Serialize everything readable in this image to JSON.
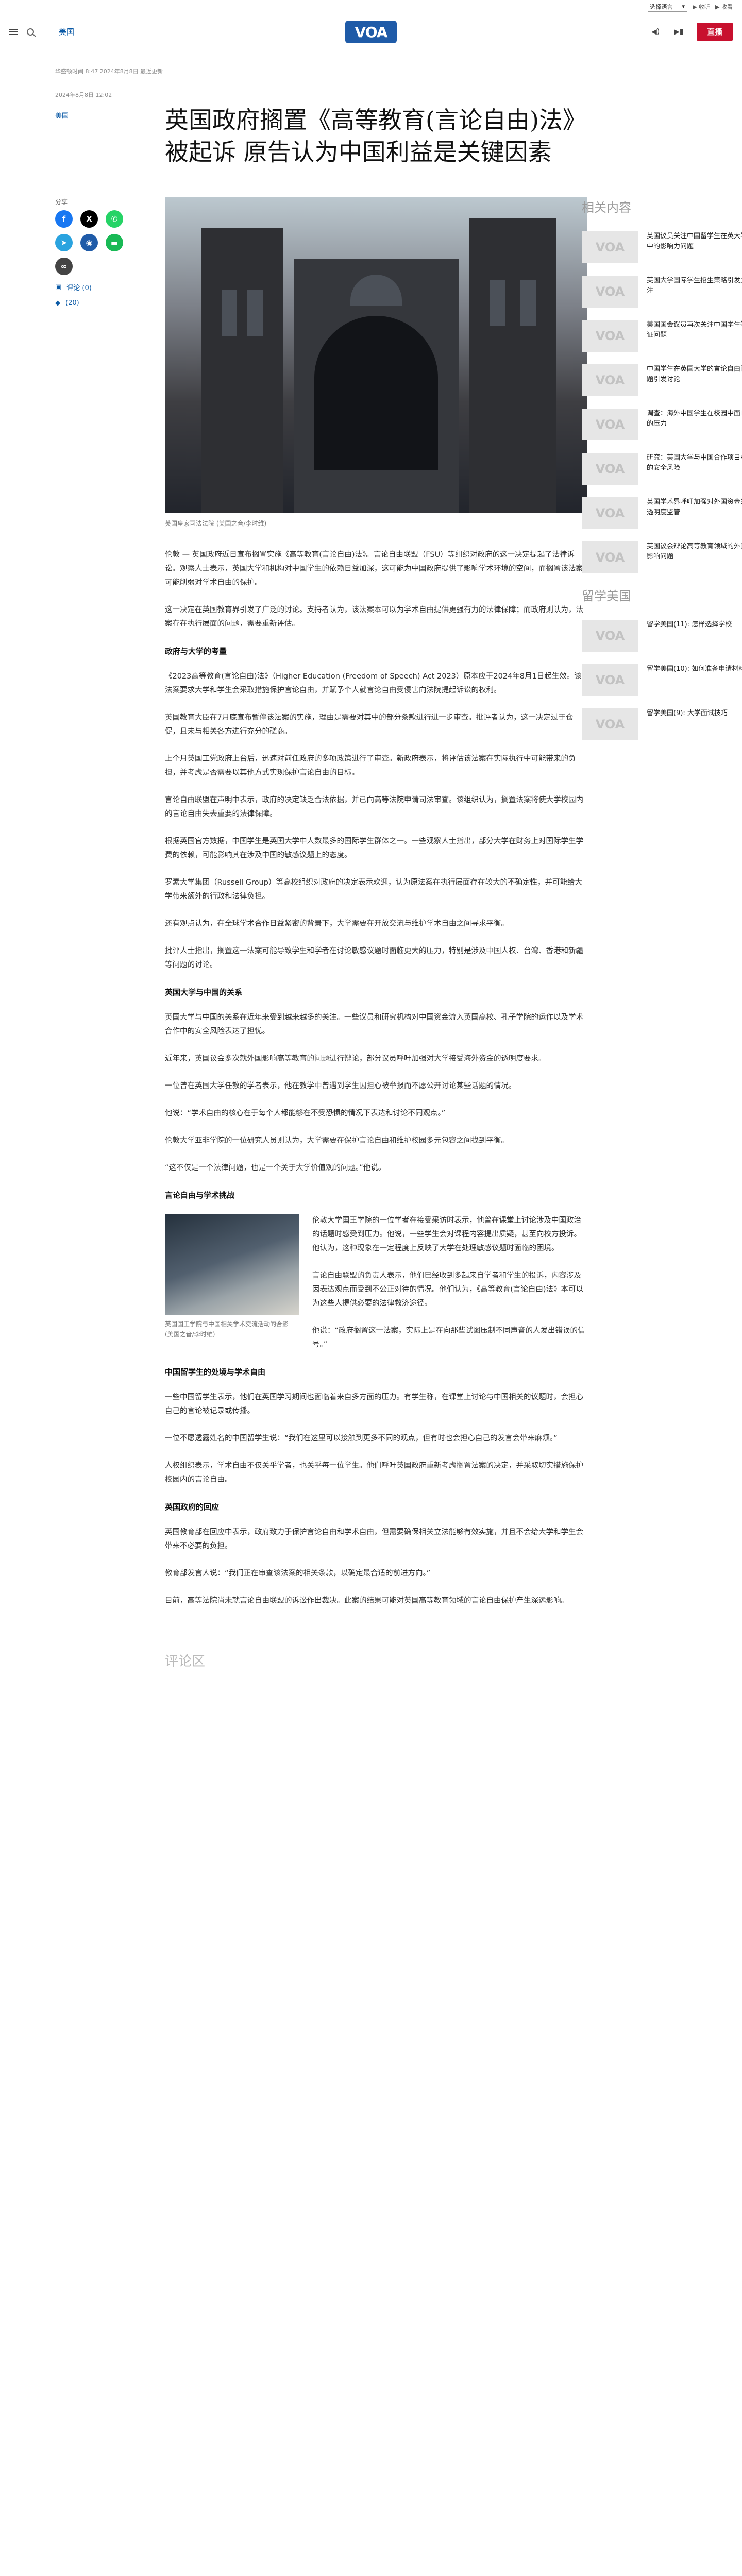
{
  "lang_strip": {
    "select_value": "选择语言",
    "links": [
      "▶ 收听",
      "▶ 收看"
    ]
  },
  "header": {
    "section_link": "美国",
    "logo_text": "VOA",
    "live_label": "直播"
  },
  "article": {
    "meta_top": "华盛顿时间 8:47 2024年8月8日 最近更新",
    "meta_published": "2024年8月8日 12:02",
    "category": "美国",
    "title": "英国政府搁置《高等教育(言论自由)法》被起诉 原告认为中国利益是关键因素",
    "hero_caption": "英国皇家司法法院 (美国之音/李时维)"
  },
  "share": {
    "label": "分享",
    "stats": [
      "评论 (0)",
      "(20)"
    ]
  },
  "body": [
    {
      "type": "p",
      "text": "伦敦 — 英国政府近日宣布搁置实施《高等教育(言论自由)法》。言论自由联盟（FSU）等组织对政府的这一决定提起了法律诉讼。观察人士表示，英国大学和机构对中国学生的依赖日益加深，这可能为中国政府提供了影响学术环境的空间，而搁置该法案可能削弱对学术自由的保护。"
    },
    {
      "type": "p",
      "text": "这一决定在英国教育界引发了广泛的讨论。支持者认为，该法案本可以为学术自由提供更强有力的法律保障；而政府则认为，法案存在执行层面的问题，需要重新评估。"
    },
    {
      "type": "h2",
      "text": "政府与大学的考量"
    },
    {
      "type": "p",
      "text": "《2023高等教育(言论自由)法》（Higher Education (Freedom of Speech) Act 2023）原本应于2024年8月1日起生效。该法案要求大学和学生会采取措施保护言论自由，并赋予个人就言论自由受侵害向法院提起诉讼的权利。"
    },
    {
      "type": "p",
      "text": "英国教育大臣在7月底宣布暂停该法案的实施，理由是需要对其中的部分条款进行进一步审查。批评者认为，这一决定过于仓促，且未与相关各方进行充分的磋商。"
    },
    {
      "type": "p",
      "text": "上个月英国工党政府上台后，迅速对前任政府的多项政策进行了审查。新政府表示，将评估该法案在实际执行中可能带来的负担，并考虑是否需要以其他方式实现保护言论自由的目标。"
    },
    {
      "type": "p",
      "text": "言论自由联盟在声明中表示，政府的决定缺乏合法依据，并已向高等法院申请司法审查。该组织认为，搁置法案将使大学校园内的言论自由失去重要的法律保障。"
    },
    {
      "type": "p",
      "text": "根据英国官方数据，中国学生是英国大学中人数最多的国际学生群体之一。一些观察人士指出，部分大学在财务上对国际学生学费的依赖，可能影响其在涉及中国的敏感议题上的态度。"
    },
    {
      "type": "p",
      "text": "罗素大学集团（Russell Group）等高校组织对政府的决定表示欢迎，认为原法案在执行层面存在较大的不确定性，并可能给大学带来额外的行政和法律负担。"
    },
    {
      "type": "p",
      "text": "还有观点认为，在全球学术合作日益紧密的背景下，大学需要在开放交流与维护学术自由之间寻求平衡。"
    },
    {
      "type": "p",
      "text": "批评人士指出，搁置这一法案可能导致学生和学者在讨论敏感议题时面临更大的压力，特别是涉及中国人权、台湾、香港和新疆等问题的讨论。"
    },
    {
      "type": "h2",
      "text": "英国大学与中国的关系"
    },
    {
      "type": "p",
      "text": "英国大学与中国的关系在近年来受到越来越多的关注。一些议员和研究机构对中国资金流入英国高校、孔子学院的运作以及学术合作中的安全风险表达了担忧。"
    },
    {
      "type": "p",
      "text": "近年来，英国议会多次就外国影响高等教育的问题进行辩论，部分议员呼吁加强对大学接受海外资金的透明度要求。"
    },
    {
      "type": "p",
      "text": "一位曾在英国大学任教的学者表示，他在教学中曾遇到学生因担心被举报而不愿公开讨论某些话题的情况。"
    },
    {
      "type": "p",
      "text": "他说：“学术自由的核心在于每个人都能够在不受恐惧的情况下表达和讨论不同观点。”"
    },
    {
      "type": "p",
      "text": "伦敦大学亚非学院的一位研究人员则认为，大学需要在保护言论自由和维护校园多元包容之间找到平衡。"
    },
    {
      "type": "p",
      "text": "“这不仅是一个法律问题，也是一个关于大学价值观的问题。”他说。"
    },
    {
      "type": "h2",
      "text": "言论自由与学术挑战"
    },
    {
      "type": "p",
      "figure": true,
      "text": "伦敦大学国王学院的一位学者在接受采访时表示，他曾在课堂上讨论涉及中国政治的话题时感受到压力。他说，一些学生会对课程内容提出质疑，甚至向校方投诉。他认为，这种现象在一定程度上反映了大学在处理敏感议题时面临的困境。"
    },
    {
      "type": "p",
      "text": "言论自由联盟的负责人表示，他们已经收到多起来自学者和学生的投诉，内容涉及因表达观点而受到不公正对待的情况。他们认为，《高等教育(言论自由)法》本可以为这些人提供必要的法律救济途径。"
    },
    {
      "type": "p",
      "text": "他说：“政府搁置这一法案，实际上是在向那些试图压制不同声音的人发出错误的信号。”"
    },
    {
      "type": "h2",
      "text": "中国留学生的处境与学术自由"
    },
    {
      "type": "p",
      "text": "一些中国留学生表示，他们在英国学习期间也面临着来自多方面的压力。有学生称，在课堂上讨论与中国相关的议题时，会担心自己的言论被记录或传播。"
    },
    {
      "type": "p",
      "text": "一位不愿透露姓名的中国留学生说：“我们在这里可以接触到更多不同的观点，但有时也会担心自己的发言会带来麻烦。”"
    },
    {
      "type": "p",
      "text": "人权组织表示，学术自由不仅关乎学者，也关乎每一位学生。他们呼吁英国政府重新考虑搁置法案的决定，并采取切实措施保护校园内的言论自由。"
    },
    {
      "type": "h2",
      "text": "英国政府的回应"
    },
    {
      "type": "p",
      "text": "英国教育部在回应中表示，政府致力于保护言论自由和学术自由，但需要确保相关立法能够有效实施，并且不会给大学和学生会带来不必要的负担。"
    },
    {
      "type": "p",
      "text": "教育部发言人说：“我们正在审查该法案的相关条款，以确定最合适的前进方向。”"
    },
    {
      "type": "p",
      "text": "目前，高等法院尚未就言论自由联盟的诉讼作出裁决。此案的结果可能对英国高等教育领域的言论自由保护产生深远影响。"
    }
  ],
  "inline_figure": {
    "caption": "英国国王学院与中国相关学术交流活动的合影 (美国之音/李时维)"
  },
  "comments_label": "评论区",
  "sidebar": {
    "related_heading": "相关内容",
    "related": [
      "英国议员关注中国留学生在英大学中的影响力问题",
      "英国大学国际学生招生策略引发关注",
      "美国国会议员再次关注中国学生签证问题",
      "中国学生在英国大学的言论自由问题引发讨论",
      "调查：海外中国学生在校园中面临的压力",
      "研究：英国大学与中国合作项目中的安全风险",
      "英国学术界呼吁加强对外国资金的透明度监管",
      "英国议会辩论高等教育领域的外国影响问题"
    ],
    "study_heading": "留学美国",
    "study": [
      "留学美国(11): 怎样选择学校",
      "留学美国(10): 如何准备申请材料",
      "留学美国(9): 大学面试技巧"
    ],
    "thumb_label": "VOA"
  }
}
